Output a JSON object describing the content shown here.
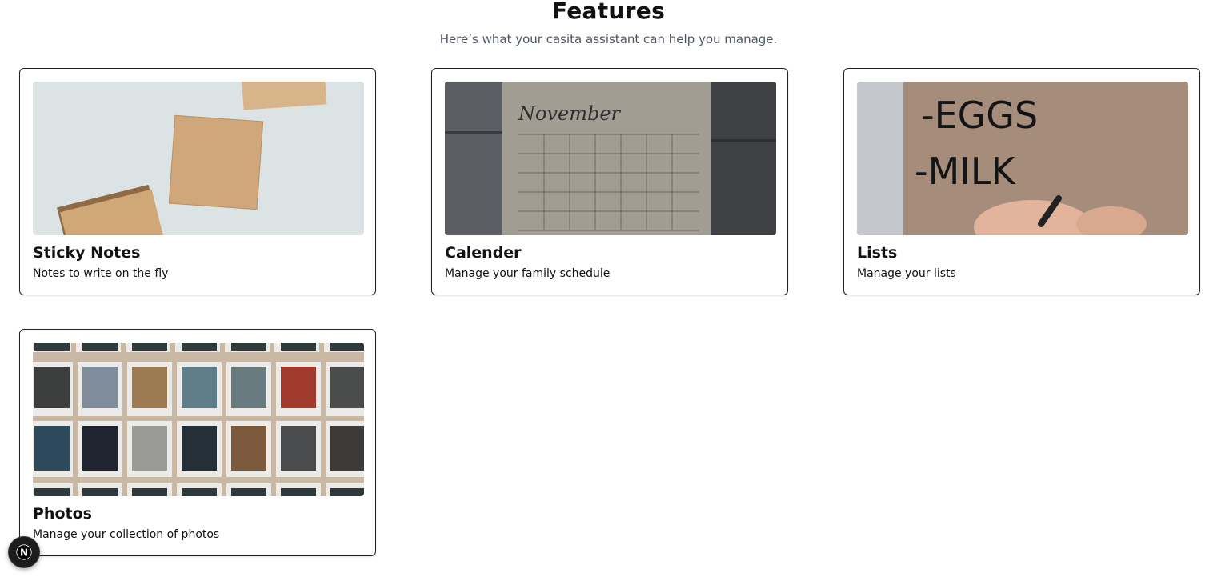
{
  "header": {
    "title": "Features",
    "subtitle": "Here’s what your casita assistant can help you manage."
  },
  "features": [
    {
      "title": "Sticky Notes",
      "description": "Notes to write on the fly",
      "image": "sticky-notes-photo"
    },
    {
      "title": "Calender",
      "description": "Manage your family schedule",
      "image": "calendar-photo",
      "image_text": "November"
    },
    {
      "title": "Lists",
      "description": "Manage your lists",
      "image": "grocery-list-photo",
      "image_text": [
        "-EGGS",
        "-MILK"
      ]
    },
    {
      "title": "Photos",
      "description": "Manage your collection of photos",
      "image": "polaroid-wall-photo"
    }
  ],
  "dev_indicator": {
    "label": "N",
    "icon": "nextjs-logo-icon"
  }
}
